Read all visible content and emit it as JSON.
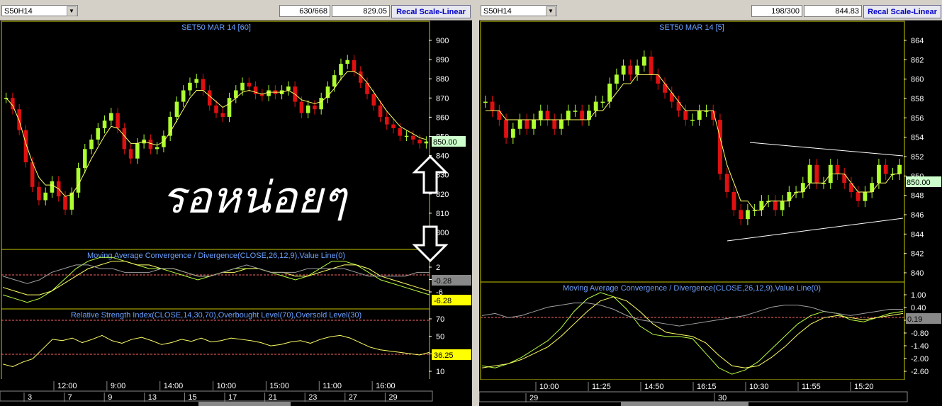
{
  "left": {
    "symbol": "S50H14",
    "bars_info": "630/668",
    "price": "829.05",
    "recal_label": "Recal Scale-Linear",
    "chart_title": "SET50 MAR 14   [60]",
    "last_price_label": "850.00",
    "annotation_text": "รอหน่อยๆ",
    "macd_title": "Moving Average Convergence / Divergence(CLOSE,26,12,9),Value Line(0)",
    "macd_value1": "-0.28",
    "macd_value2": "-6.28",
    "rsi_title": "Relative Strength Index(CLOSE,14,30,70),Overbought Level(70),Oversold Level(30)",
    "rsi_value": "36.25",
    "price_ticks": [
      "900",
      "890",
      "880",
      "870",
      "860",
      "850",
      "840",
      "830",
      "820",
      "810",
      "800"
    ],
    "macd_ticks": [
      "2",
      "-2",
      "-6"
    ],
    "rsi_ticks": [
      "70",
      "50",
      "30",
      "10"
    ],
    "time_labels": [
      "12:00",
      "9:00",
      "14:00",
      "10:00",
      "15:00",
      "11:00",
      "16:00"
    ],
    "date_labels": [
      "3",
      "7",
      "9",
      "13",
      "15",
      "17",
      "21",
      "23",
      "27",
      "29"
    ]
  },
  "right": {
    "symbol": "S50H14",
    "bars_info": "198/300",
    "price": "844.83",
    "recal_label": "Recal Scale-Linear",
    "chart_title": "SET50 MAR 14   [5]",
    "last_price_label": "850.00",
    "macd_title": "Moving Average Convergence / Divergence(CLOSE,26,12,9),Value Line(0)",
    "macd_value": "0.19",
    "price_ticks": [
      "864",
      "862",
      "860",
      "858",
      "856",
      "854",
      "852",
      "850",
      "848",
      "846",
      "844",
      "842",
      "840"
    ],
    "macd_ticks": [
      "1.00",
      "0.40",
      "-0.20",
      "-0.80",
      "-1.40",
      "-2.00",
      "-2.60"
    ],
    "time_labels": [
      "10:00",
      "11:25",
      "14:50",
      "16:15",
      "10:30",
      "11:55",
      "15:20"
    ],
    "date_labels": [
      "29",
      "30"
    ]
  },
  "colors": {
    "up": "#adff2f",
    "down": "#e01010",
    "ma": "#ffff66",
    "frame": "#c8c800",
    "axis": "#ffffff",
    "title": "#6aa0ff",
    "highlight": "#ffff00"
  },
  "chart_data": [
    {
      "type": "candlestick",
      "title": "SET50 MAR 14 [60]",
      "ylim": [
        795,
        905
      ],
      "close": [
        872,
        866,
        855,
        838,
        825,
        818,
        822,
        828,
        820,
        813,
        822,
        835,
        845,
        850,
        856,
        860,
        864,
        856,
        845,
        840,
        848,
        850,
        845,
        846,
        852,
        862,
        870,
        876,
        880,
        882,
        876,
        868,
        864,
        862,
        872,
        876,
        880,
        878,
        874,
        873,
        876,
        874,
        876,
        878,
        870,
        864,
        868,
        866,
        872,
        878,
        884,
        890,
        892,
        886,
        880,
        874,
        868,
        862,
        858,
        856,
        852,
        852,
        850,
        848,
        849
      ],
      "ma_values": [
        872,
        868,
        860,
        848,
        838,
        830,
        826,
        826,
        824,
        820,
        821,
        826,
        833,
        840,
        846,
        852,
        857,
        856,
        852,
        848,
        848,
        849,
        848,
        847,
        849,
        854,
        860,
        866,
        872,
        876,
        876,
        873,
        870,
        867,
        869,
        872,
        875,
        876,
        875,
        874,
        875,
        875,
        875,
        876,
        874,
        871,
        870,
        869,
        870,
        873,
        877,
        882,
        886,
        886,
        884,
        880,
        875,
        870,
        865,
        861,
        857,
        855,
        853,
        851,
        850
      ]
    },
    {
      "type": "line",
      "title": "Moving Average Convergence / Divergence(CLOSE,26,12,9),Value Line(0)",
      "ylim": [
        -9,
        5
      ],
      "series": [
        {
          "name": "MACD",
          "values": [
            -6,
            -7,
            -8,
            -7,
            -5,
            -2,
            1,
            3,
            4,
            4,
            3,
            2,
            1,
            1,
            0,
            -1,
            -2,
            -1,
            0,
            1,
            1,
            1,
            0,
            -1,
            -2,
            -1,
            1,
            3,
            3,
            2,
            0,
            -2,
            -3,
            -4,
            -5,
            -6
          ]
        },
        {
          "name": "Signal",
          "values": [
            -4,
            -5,
            -6,
            -6,
            -5,
            -3,
            -1,
            1,
            2,
            3,
            3,
            2,
            2,
            1,
            1,
            0,
            -1,
            -1,
            0,
            0,
            1,
            1,
            0,
            0,
            -1,
            -1,
            0,
            1,
            2,
            2,
            1,
            -1,
            -2,
            -3,
            -4,
            -5
          ]
        },
        {
          "name": "Value Line",
          "values": [
            -1,
            -2,
            -3,
            -2,
            0,
            1,
            2,
            2,
            1,
            1,
            0,
            0,
            0,
            1,
            1,
            0,
            -1,
            -1,
            0,
            1,
            2,
            1,
            0,
            0,
            0,
            1,
            1,
            1,
            1,
            0,
            -1,
            -1,
            -1,
            -1,
            0,
            0
          ]
        }
      ]
    },
    {
      "type": "line",
      "title": "Relative Strength Index(CLOSE,14,30,70),Overbought Level(70),Oversold Level(30)",
      "ylim": [
        0,
        85
      ],
      "series": [
        {
          "name": "RSI",
          "values": [
            22,
            18,
            25,
            30,
            45,
            60,
            58,
            62,
            55,
            60,
            66,
            58,
            54,
            60,
            63,
            58,
            52,
            55,
            60,
            57,
            62,
            56,
            58,
            62,
            60,
            58,
            55,
            50,
            52,
            56,
            58,
            54,
            60,
            64,
            66,
            62,
            55,
            48,
            44,
            42,
            40,
            38,
            36,
            40
          ]
        }
      ]
    },
    {
      "type": "candlestick",
      "title": "SET50 MAR 14 [5]",
      "ylim": [
        838.5,
        865.5
      ],
      "close": [
        858,
        857,
        856,
        854,
        855,
        856,
        855,
        856,
        857,
        856,
        855,
        856,
        857,
        857,
        856,
        857,
        858,
        858,
        860,
        861,
        862,
        861,
        862,
        863,
        861,
        860,
        859,
        858,
        857,
        856,
        856,
        857,
        857,
        856,
        850,
        848,
        846,
        845,
        846,
        846,
        847,
        847,
        846,
        847,
        848,
        848,
        849,
        851,
        849,
        849,
        851,
        850,
        849,
        848,
        847,
        848,
        849,
        851,
        850,
        850,
        851
      ],
      "ma_values": [
        857,
        857,
        857,
        856,
        856,
        856,
        856,
        856,
        856,
        856,
        856,
        856,
        856,
        856,
        856,
        856,
        857,
        857,
        858,
        859,
        860,
        860,
        861,
        861,
        861,
        861,
        860,
        859,
        858,
        857,
        857,
        857,
        857,
        857,
        854,
        851,
        849,
        847,
        847,
        846,
        846,
        847,
        847,
        847,
        847,
        848,
        848,
        849,
        849,
        849,
        850,
        850,
        850,
        849,
        848,
        848,
        848,
        849,
        849,
        850,
        850
      ]
    },
    {
      "type": "line",
      "title": "Moving Average Convergence / Divergence(CLOSE,26,12,9),Value Line(0)",
      "ylim": [
        -3.0,
        1.4
      ],
      "series": [
        {
          "name": "MACD",
          "values": [
            -2.4,
            -2.5,
            -2.3,
            -2.0,
            -1.6,
            -1.2,
            -0.6,
            0.2,
            0.8,
            1.1,
            0.9,
            0.3,
            -0.5,
            -0.9,
            -1.0,
            -1.0,
            -1.1,
            -1.8,
            -2.5,
            -2.8,
            -2.6,
            -2.2,
            -1.6,
            -1.0,
            -0.4,
            0.0,
            0.2,
            0.1,
            -0.2,
            -0.3,
            -0.1,
            0.1,
            0.2
          ]
        },
        {
          "name": "Signal",
          "values": [
            -2.5,
            -2.4,
            -2.3,
            -2.1,
            -1.8,
            -1.5,
            -1.0,
            -0.4,
            0.2,
            0.7,
            0.9,
            0.7,
            0.2,
            -0.4,
            -0.8,
            -0.9,
            -1.0,
            -1.3,
            -1.9,
            -2.4,
            -2.5,
            -2.4,
            -2.0,
            -1.5,
            -0.9,
            -0.4,
            -0.1,
            0.0,
            -0.1,
            -0.2,
            -0.1,
            0.0,
            0.1
          ]
        },
        {
          "name": "Value Line",
          "values": [
            0.0,
            0.1,
            -0.1,
            0.0,
            0.2,
            0.4,
            0.5,
            0.6,
            0.6,
            0.5,
            0.3,
            0.0,
            -0.2,
            -0.3,
            -0.4,
            -0.5,
            -0.4,
            -0.3,
            -0.2,
            -0.1,
            0.0,
            0.2,
            0.4,
            0.5,
            0.5,
            0.4,
            0.2,
            0.1,
            0.0,
            0.1,
            0.2,
            0.3,
            0.3
          ]
        }
      ]
    }
  ]
}
